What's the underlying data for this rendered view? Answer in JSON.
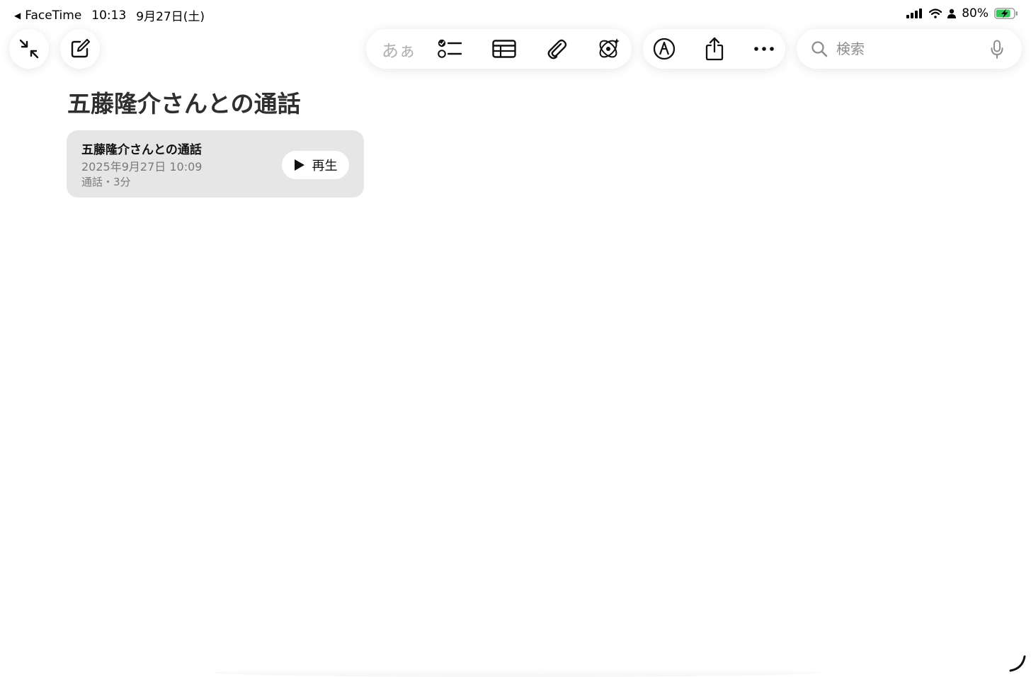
{
  "status_bar": {
    "back_app": "FaceTime",
    "time": "10:13",
    "date": "9月27日(土)",
    "battery_percent": "80%",
    "battery_color": "#34c759"
  },
  "toolbar": {
    "format_label": "あぁ",
    "left_icons": [
      "collapse-icon",
      "compose-icon"
    ],
    "tool_icons": [
      "checklist-icon",
      "table-icon",
      "paperclip-icon",
      "sparkle-icon",
      "markup-pen-icon",
      "share-icon",
      "more-icon"
    ]
  },
  "search": {
    "placeholder": "検索"
  },
  "note": {
    "title": "五藤隆介さんとの通話",
    "recording": {
      "title": "五藤隆介さんとの通話",
      "date": "2025年9月27日 10:09",
      "meta": "通話・3分",
      "play_label": "再生"
    }
  }
}
